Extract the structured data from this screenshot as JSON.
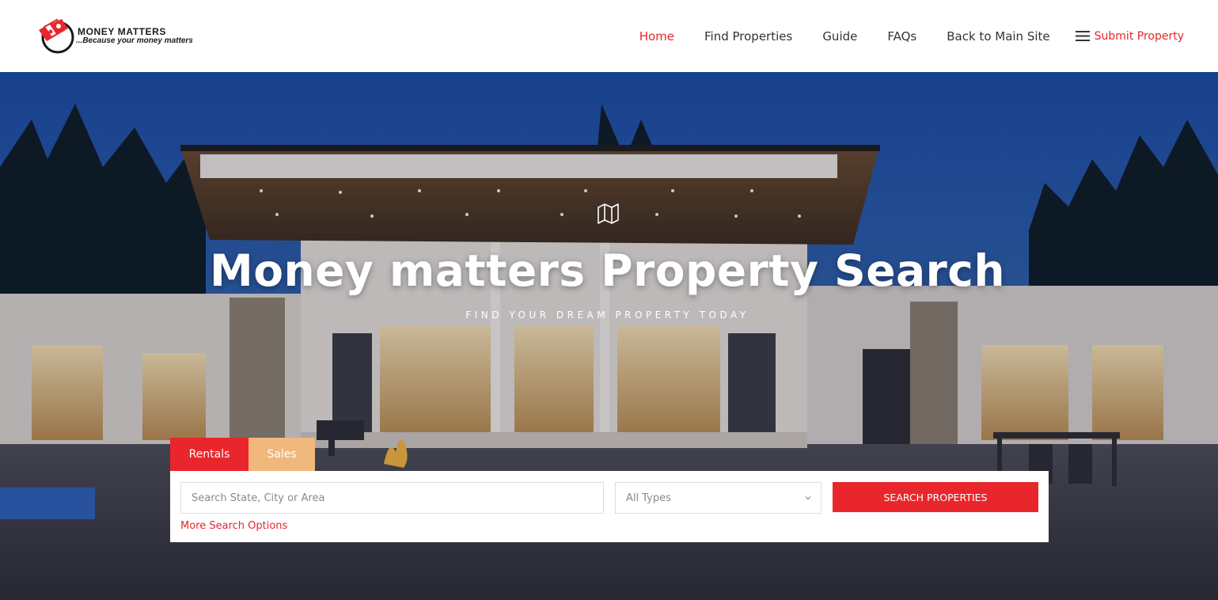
{
  "colors": {
    "accent_red": "#e8262b",
    "sales_tab": "#f0b87c",
    "nav_text": "#333333",
    "white": "#ffffff"
  },
  "logo": {
    "title": "MONEY MATTERS",
    "tagline": "...Because your money matters",
    "icon": "money-bills-logo-icon"
  },
  "nav": {
    "items": [
      {
        "label": "Home",
        "active": true
      },
      {
        "label": "Find Properties",
        "active": false
      },
      {
        "label": "Guide",
        "active": false
      },
      {
        "label": "FAQs",
        "active": false
      },
      {
        "label": "Back to Main Site",
        "active": false
      }
    ],
    "submit": {
      "icon": "hamburger-menu-icon",
      "label": "Submit Property"
    }
  },
  "hero": {
    "icon": "map-icon",
    "title": "Money matters Property Search",
    "subtitle": "FIND YOUR DREAM PROPERTY TODAY"
  },
  "search": {
    "tabs": [
      {
        "label": "Rentals",
        "active": true
      },
      {
        "label": "Sales",
        "active": false
      }
    ],
    "location_placeholder": "Search State, City or Area",
    "location_value": "",
    "type_selected": "All Types",
    "button_label": "SEARCH PROPERTIES",
    "more_options_label": "More Search Options"
  }
}
